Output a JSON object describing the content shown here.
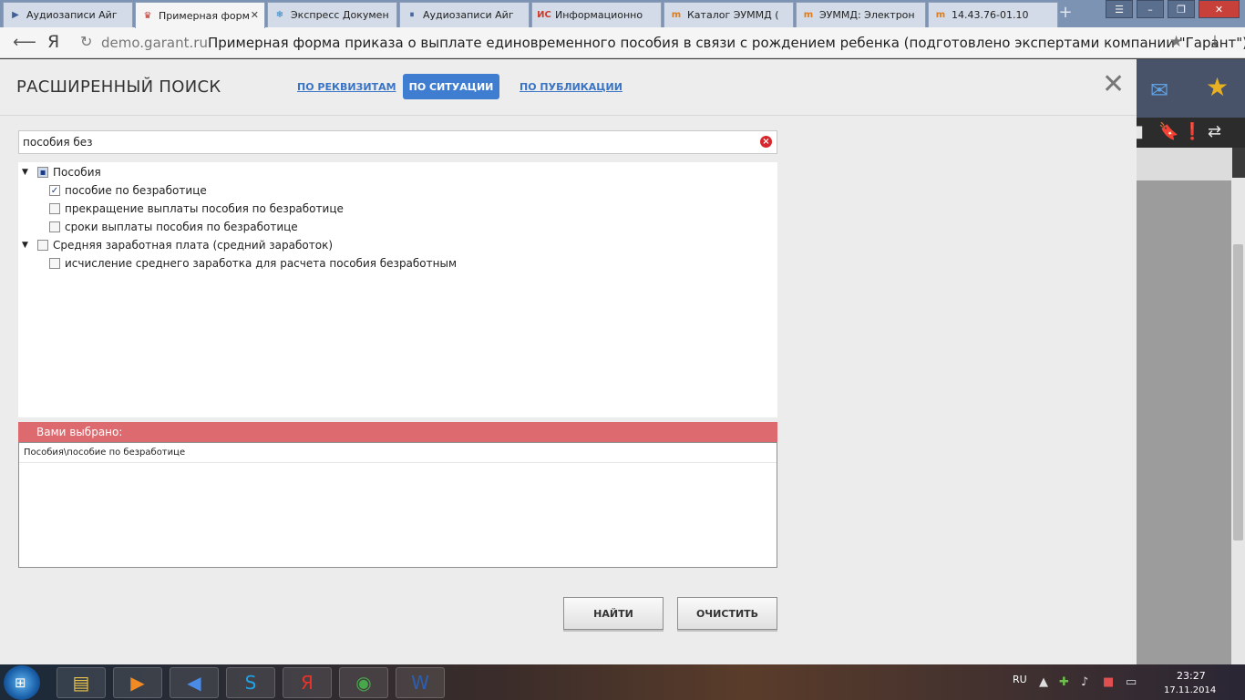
{
  "tabs": [
    {
      "title": "Аудиозаписи Айг",
      "icon": "play-icon",
      "icon_color": "#3f5f99"
    },
    {
      "title": "Примерная форм",
      "icon": "garant-icon",
      "icon_color": "#c0392b",
      "active": true
    },
    {
      "title": "Экспресс Докумен",
      "icon": "snowflake-icon",
      "icon_color": "#2b82c4"
    },
    {
      "title": "Аудиозаписи Айг",
      "icon": "pause-icon",
      "icon_color": "#3f5f99"
    },
    {
      "title": "Информационно",
      "icon": "ic-icon",
      "icon_color": "#d03a2a"
    },
    {
      "title": "Каталог ЭУММД (",
      "icon": "eummd-icon",
      "icon_color": "#e07b1a"
    },
    {
      "title": "ЭУММД: Электрон",
      "icon": "eummd-icon",
      "icon_color": "#e07b1a"
    },
    {
      "title": "14.43.76-01.10",
      "icon": "eummd-icon",
      "icon_color": "#e07b1a"
    }
  ],
  "address": {
    "host": "demo.garant.ru",
    "title": "Примерная форма приказа о выплате единовременного пособия в связи с рождением ребенка (подготовлено экспертами компании \"Гарант\")"
  },
  "dialog": {
    "title": "РАСШИРЕННЫЙ ПОИСК",
    "modes": {
      "by_requisites": "ПО РЕКВИЗИТАМ",
      "by_situation": "ПО СИТУАЦИИ",
      "by_publication": "ПО ПУБЛИКАЦИИ"
    },
    "search_value": "пособия без",
    "tree": [
      {
        "label": "Пособия",
        "level": 0,
        "state": "partial",
        "expanded": true
      },
      {
        "label": "пособие по безработице",
        "level": 1,
        "state": "checked"
      },
      {
        "label": "прекращение выплаты пособия по безработице",
        "level": 1,
        "state": "unchecked"
      },
      {
        "label": "сроки выплаты пособия по безработице",
        "level": 1,
        "state": "unchecked"
      },
      {
        "label": "Средняя заработная плата (средний заработок)",
        "level": 0,
        "state": "unchecked",
        "expanded": true
      },
      {
        "label": "исчисление среднего заработка для расчета пособия безработным",
        "level": 1,
        "state": "unchecked"
      }
    ],
    "selected_header": "Вами выбрано:",
    "selected_items": [
      "Пособия\\пособие по безработице"
    ],
    "buttons": {
      "find": "НАЙТИ",
      "clear": "ОЧИСТИТЬ"
    }
  },
  "taskbar": {
    "apps": [
      {
        "icon": "folder-icon",
        "color": "#e8c24a"
      },
      {
        "icon": "media-player-icon",
        "color": "#f08a24"
      },
      {
        "icon": "volume-app-icon",
        "color": "#4a8be8"
      },
      {
        "icon": "skype-icon",
        "color": "#1fa3e8"
      },
      {
        "icon": "yandex-browser-icon",
        "color": "#e8332a"
      },
      {
        "icon": "chrome-icon",
        "color": "#46a84a"
      },
      {
        "icon": "word-icon",
        "color": "#2b5fb4"
      }
    ],
    "lang": "RU",
    "time": "23:27",
    "date": "17.11.2014"
  },
  "colors": {
    "accent": "#3f7dd1",
    "selected_header": "#dc6a6f"
  }
}
